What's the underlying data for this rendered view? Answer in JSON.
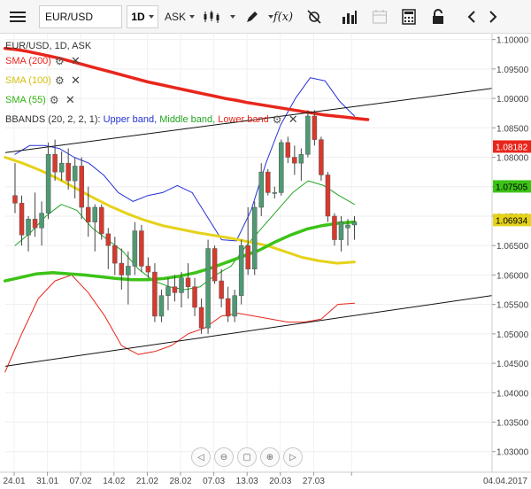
{
  "toolbar": {
    "symbol": "EUR/USD",
    "timeframe": "1D",
    "price_type": "ASK",
    "fx_label": "f(x)"
  },
  "legend": {
    "title": "EUR/USD, 1D, ASK",
    "indicators": [
      {
        "label": "SMA (200)",
        "color": "#e8261c"
      },
      {
        "label": "SMA (100)",
        "color": "#e5d21a"
      },
      {
        "label": "SMA (55)",
        "color": "#3cc317"
      }
    ],
    "bbands": {
      "prefix": "BBANDS (20, 2, 2, 1): ",
      "upper": "Upper band,",
      "middle": " Middle band,",
      "lower": " Lower band",
      "upper_color": "#2432d6",
      "middle_color": "#22a522",
      "lower_color": "#e8261c"
    }
  },
  "price_tags": [
    {
      "value": 1.08182,
      "label": "1.08182",
      "bg": "#e8261c",
      "fg": "#ffffff"
    },
    {
      "value": 1.07505,
      "label": "1.07505",
      "bg": "#3cc317",
      "fg": "#000000"
    },
    {
      "value": 1.06934,
      "label": "1.06934",
      "bg": "#e5d21a",
      "fg": "#000000"
    }
  ],
  "chart_data": {
    "type": "candlestick",
    "y_ticks": [
      "1.10000",
      "1.09500",
      "1.09000",
      "1.08500",
      "1.08000",
      "1.07500",
      "1.07000",
      "1.06500",
      "1.06000",
      "1.05500",
      "1.05000",
      "1.04500",
      "1.04000",
      "1.03500",
      "1.03000"
    ],
    "ylim": [
      1.0265,
      1.101
    ],
    "x_ticks": [
      "24.01",
      "31.01",
      "07.02",
      "14.02",
      "21.02",
      "28.02",
      "07.03",
      "13.03",
      "20.03",
      "27.03",
      "04.04.2017"
    ],
    "colors": {
      "up": "#4e9a73",
      "down": "#d8392c",
      "sma200": "#e8261c",
      "sma100": "#e5d21a",
      "sma55": "#3cc317",
      "bb_upper": "#2432d6",
      "bb_middle": "#22a522",
      "bb_lower": "#e8261c",
      "trend": "#111111"
    },
    "candles": [
      {
        "o": 1.0735,
        "h": 1.079,
        "l": 1.0705,
        "c": 1.0722
      },
      {
        "o": 1.0722,
        "h": 1.0735,
        "l": 1.065,
        "c": 1.0668
      },
      {
        "o": 1.0668,
        "h": 1.07,
        "l": 1.064,
        "c": 1.0695
      },
      {
        "o": 1.0695,
        "h": 1.074,
        "l": 1.0665,
        "c": 1.068
      },
      {
        "o": 1.068,
        "h": 1.0725,
        "l": 1.065,
        "c": 1.0705
      },
      {
        "o": 1.0705,
        "h": 1.0825,
        "l": 1.0695,
        "c": 1.0805
      },
      {
        "o": 1.0805,
        "h": 1.083,
        "l": 1.076,
        "c": 1.0775
      },
      {
        "o": 1.0775,
        "h": 1.081,
        "l": 1.076,
        "c": 1.079
      },
      {
        "o": 1.079,
        "h": 1.0815,
        "l": 1.0745,
        "c": 1.076
      },
      {
        "o": 1.076,
        "h": 1.08,
        "l": 1.073,
        "c": 1.0785
      },
      {
        "o": 1.0785,
        "h": 1.08,
        "l": 1.0695,
        "c": 1.0715
      },
      {
        "o": 1.0715,
        "h": 1.075,
        "l": 1.0665,
        "c": 1.069
      },
      {
        "o": 1.069,
        "h": 1.072,
        "l": 1.064,
        "c": 1.0715
      },
      {
        "o": 1.0715,
        "h": 1.072,
        "l": 1.066,
        "c": 1.067
      },
      {
        "o": 1.067,
        "h": 1.068,
        "l": 1.061,
        "c": 1.065
      },
      {
        "o": 1.065,
        "h": 1.0665,
        "l": 1.06,
        "c": 1.062
      },
      {
        "o": 1.062,
        "h": 1.0645,
        "l": 1.0575,
        "c": 1.06
      },
      {
        "o": 1.06,
        "h": 1.064,
        "l": 1.055,
        "c": 1.0615
      },
      {
        "o": 1.0615,
        "h": 1.069,
        "l": 1.06,
        "c": 1.0675
      },
      {
        "o": 1.0675,
        "h": 1.0685,
        "l": 1.0605,
        "c": 1.0615
      },
      {
        "o": 1.0615,
        "h": 1.063,
        "l": 1.0595,
        "c": 1.0605
      },
      {
        "o": 1.0605,
        "h": 1.062,
        "l": 1.052,
        "c": 1.053
      },
      {
        "o": 1.053,
        "h": 1.0575,
        "l": 1.052,
        "c": 1.0565
      },
      {
        "o": 1.0565,
        "h": 1.0595,
        "l": 1.054,
        "c": 1.058
      },
      {
        "o": 1.058,
        "h": 1.06,
        "l": 1.0555,
        "c": 1.057
      },
      {
        "o": 1.057,
        "h": 1.0605,
        "l": 1.0545,
        "c": 1.0595
      },
      {
        "o": 1.0595,
        "h": 1.062,
        "l": 1.056,
        "c": 1.058
      },
      {
        "o": 1.058,
        "h": 1.0595,
        "l": 1.053,
        "c": 1.0545
      },
      {
        "o": 1.0545,
        "h": 1.056,
        "l": 1.05,
        "c": 1.051
      },
      {
        "o": 1.051,
        "h": 1.066,
        "l": 1.05,
        "c": 1.0645
      },
      {
        "o": 1.0645,
        "h": 1.065,
        "l": 1.0585,
        "c": 1.059
      },
      {
        "o": 1.059,
        "h": 1.061,
        "l": 1.0545,
        "c": 1.056
      },
      {
        "o": 1.056,
        "h": 1.058,
        "l": 1.052,
        "c": 1.053
      },
      {
        "o": 1.053,
        "h": 1.0575,
        "l": 1.052,
        "c": 1.0565
      },
      {
        "o": 1.0565,
        "h": 1.066,
        "l": 1.055,
        "c": 1.065
      },
      {
        "o": 1.065,
        "h": 1.0715,
        "l": 1.06,
        "c": 1.061
      },
      {
        "o": 1.061,
        "h": 1.0725,
        "l": 1.06,
        "c": 1.0715
      },
      {
        "o": 1.0715,
        "h": 1.079,
        "l": 1.07,
        "c": 1.0775
      },
      {
        "o": 1.0775,
        "h": 1.078,
        "l": 1.0735,
        "c": 1.074
      },
      {
        "o": 1.074,
        "h": 1.075,
        "l": 1.073,
        "c": 1.074
      },
      {
        "o": 1.074,
        "h": 1.083,
        "l": 1.0735,
        "c": 1.0825
      },
      {
        "o": 1.0825,
        "h": 1.0835,
        "l": 1.079,
        "c": 1.08
      },
      {
        "o": 1.08,
        "h": 1.082,
        "l": 1.077,
        "c": 1.079
      },
      {
        "o": 1.079,
        "h": 1.0815,
        "l": 1.076,
        "c": 1.0805
      },
      {
        "o": 1.0805,
        "h": 1.088,
        "l": 1.08,
        "c": 1.087
      },
      {
        "o": 1.087,
        "h": 1.088,
        "l": 1.082,
        "c": 1.083
      },
      {
        "o": 1.083,
        "h": 1.0835,
        "l": 1.076,
        "c": 1.077
      },
      {
        "o": 1.077,
        "h": 1.0775,
        "l": 1.069,
        "c": 1.07
      },
      {
        "o": 1.07,
        "h": 1.0705,
        "l": 1.065,
        "c": 1.066
      },
      {
        "o": 1.066,
        "h": 1.07,
        "l": 1.064,
        "c": 1.069
      },
      {
        "o": 1.068,
        "h": 1.0695,
        "l": 1.065,
        "c": 1.0685
      },
      {
        "o": 1.0685,
        "h": 1.07,
        "l": 1.066,
        "c": 1.069
      }
    ],
    "sma200": [
      1.0985,
      1.0983,
      1.098,
      1.0976,
      1.0972,
      1.0968,
      1.0963,
      1.0958,
      1.0953,
      1.0948,
      1.0943,
      1.0938,
      1.0933,
      1.0928,
      1.0924,
      1.092,
      1.0916,
      1.0912,
      1.0908,
      1.0904,
      1.09,
      1.0897,
      1.0893,
      1.089,
      1.0887,
      1.0884,
      1.0881,
      1.0878,
      1.0875,
      1.0872,
      1.087,
      1.0868,
      1.0866,
      1.0864
    ],
    "sma100": [
      1.08,
      1.079,
      1.0778,
      1.0764,
      1.0748,
      1.0732,
      1.0717,
      1.0704,
      1.0693,
      1.0684,
      1.0678,
      1.0672,
      1.0667,
      1.0662,
      1.0656,
      1.065,
      1.064,
      1.063,
      1.0624,
      1.062,
      1.0622
    ],
    "sma55": [
      1.059,
      1.0596,
      1.0602,
      1.0604,
      1.0602,
      1.06,
      1.0597,
      1.0594,
      1.0592,
      1.0592,
      1.0594,
      1.0598,
      1.0604,
      1.0612,
      1.0622,
      1.0632,
      1.0642,
      1.0656,
      1.0668,
      1.0678,
      1.0684,
      1.0688,
      1.069
    ],
    "bb_upper": [
      1.0805,
      1.082,
      1.082,
      1.0815,
      1.08,
      1.079,
      1.077,
      1.074,
      1.0725,
      1.0735,
      1.074,
      1.0752,
      1.074,
      1.07,
      1.066,
      1.0658,
      1.071,
      1.079,
      1.0855,
      1.09,
      1.0935,
      1.093,
      1.0895,
      1.087
    ],
    "bb_middle": [
      1.065,
      1.0672,
      1.07,
      1.072,
      1.071,
      1.068,
      1.066,
      1.064,
      1.061,
      1.059,
      1.058,
      1.0575,
      1.058,
      1.06,
      1.0615,
      1.065,
      1.068,
      1.071,
      1.074,
      1.076,
      1.0752,
      1.0735,
      1.072
    ],
    "bb_lower": [
      1.0435,
      1.05,
      1.056,
      1.059,
      1.06,
      1.057,
      1.053,
      1.048,
      1.0465,
      1.047,
      1.048,
      1.05,
      1.051,
      1.053,
      1.0535,
      1.053,
      1.0525,
      1.052,
      1.052,
      1.0525,
      1.055,
      1.0552
    ]
  }
}
